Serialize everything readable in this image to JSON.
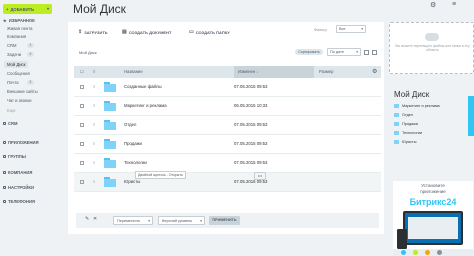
{
  "sidebar": {
    "add_button": "ДОБАВИТЬ",
    "favorites": "ИЗБРАННОЕ",
    "items": [
      {
        "label": "Живая лента"
      },
      {
        "label": "Компания"
      },
      {
        "label": "CRM",
        "badge": "1"
      },
      {
        "label": "Задачи",
        "badge": "2"
      },
      {
        "label": "Мой Диск"
      },
      {
        "label": "Сообщения"
      },
      {
        "label": "Почта",
        "badge": "2"
      },
      {
        "label": "Внешние сайты"
      },
      {
        "label": "Чат и звонки"
      },
      {
        "label": "Ещё"
      }
    ],
    "groups": [
      {
        "label": "CRM"
      },
      {
        "label": "ПРИЛОЖЕНИЯ"
      },
      {
        "label": "ГРУППЫ"
      },
      {
        "label": "КОМПАНИЯ"
      },
      {
        "label": "НАСТРОЙКИ"
      },
      {
        "label": "ТЕЛЕФОНИЯ"
      }
    ]
  },
  "page": {
    "title": "Мой Диск"
  },
  "toolbar": {
    "upload": "ЗАГРУЗИТЬ",
    "create_doc": "СОЗДАТЬ ДОКУМЕНТ",
    "create_folder": "СОЗДАТЬ ПАПКУ",
    "sort_label": "Фильтр",
    "sort_value": "Все"
  },
  "crumb": "Мой Диск",
  "storage_button": "Сортировать",
  "date_select": "По дате",
  "table": {
    "col_name": "Название",
    "col_changed": "Изменен ↓",
    "col_size": "Размер",
    "rows": [
      {
        "name": "Созданные файлы",
        "date": "07.05.2015 09:53"
      },
      {
        "name": "Маркетинг и реклама",
        "date": "06.05.2015 10:33"
      },
      {
        "name": "Отдел",
        "date": "07.05.2015 09:53"
      },
      {
        "name": "Продажи",
        "date": "07.05.2015 09:53"
      },
      {
        "name": "Технологии",
        "date": "07.05.2015 09:53"
      },
      {
        "name": "Юристы",
        "date": "07.05.2015 09:53"
      }
    ],
    "tooltip": "Двойной щелчок - Открыть",
    "more": "•••"
  },
  "footer": {
    "move": "Переместить",
    "level": "Верхний уровень",
    "apply": "ПРИМЕНИТЬ"
  },
  "right": {
    "drop_text": "Вы можете перетащить файлы или папки в эту область",
    "title": "Мой Диск",
    "items": [
      {
        "label": "Маркетинг и реклама"
      },
      {
        "label": "Отдел"
      },
      {
        "label": "Продажи"
      },
      {
        "label": "Технологии"
      },
      {
        "label": "Юристы"
      }
    ]
  },
  "promo": {
    "line1": "Установите",
    "line2": "приложение",
    "brand": "Битрикс24"
  },
  "colors": {
    "accent_green": "#bbed21",
    "folder_blue": "#7fd3f8",
    "brand_blue": "#2fc6f6"
  }
}
